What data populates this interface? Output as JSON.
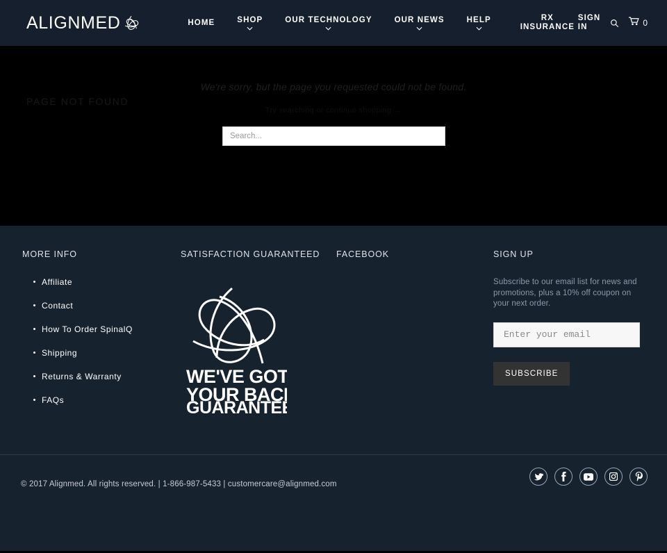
{
  "header": {
    "logo_text": "ALIGNMED",
    "logo_mark": "trefoil-knot-icon",
    "nav": [
      {
        "label": "HOME",
        "caret": false
      },
      {
        "label": "SHOP",
        "caret": true
      },
      {
        "label": "OUR TECHNOLOGY",
        "caret": true
      },
      {
        "label": "OUR NEWS",
        "caret": true
      },
      {
        "label": "HELP",
        "caret": true
      }
    ],
    "rx_line1": "RX",
    "rx_line2": "INSURANCE",
    "signin_line1": "SIGN",
    "signin_line2": "IN",
    "search_icon": "search-icon",
    "cart_icon": "cart-icon",
    "cart_count": "0",
    "bg_color": "#151f2d"
  },
  "main": {
    "page_title": "PAGE NOT FOUND",
    "sorry_message": "We're sorry, but the page you requested could not be found.",
    "try_message": "Try searching or continue shopping →",
    "search_placeholder": "Search...",
    "search_value": "",
    "bg_color": "#000000"
  },
  "footer": {
    "more_info": {
      "heading": "MORE INFO",
      "links": [
        "Affiliate",
        "Contact",
        "How To Order SpinalQ",
        "Shipping",
        "Returns & Warranty",
        "FAQs"
      ]
    },
    "satisfaction": {
      "heading": "SATISFACTION GUARANTEED",
      "badge_line1": "WE'VE GOT",
      "badge_line2": "YOUR BACK.",
      "badge_line3": "GUARANTEED.",
      "badge_icon": "trefoil-knot-icon"
    },
    "facebook": {
      "heading": "FACEBOOK"
    },
    "signup": {
      "heading": "SIGN UP",
      "description": "Subscribe to our email list for news and promotions, plus a 10% off coupon on your next order.",
      "email_placeholder": "Enter your email",
      "email_value": "",
      "subscribe_label": "SUBSCRIBE"
    },
    "bg_color": "#17222f"
  },
  "bottom": {
    "copyright": "© 2017 Alignmed. All rights reserved. | 1-866-987-5433 | customercare@alignmed.com",
    "socials": [
      {
        "name": "twitter-icon"
      },
      {
        "name": "facebook-icon"
      },
      {
        "name": "youtube-icon"
      },
      {
        "name": "instagram-icon"
      },
      {
        "name": "pinterest-icon"
      }
    ]
  }
}
